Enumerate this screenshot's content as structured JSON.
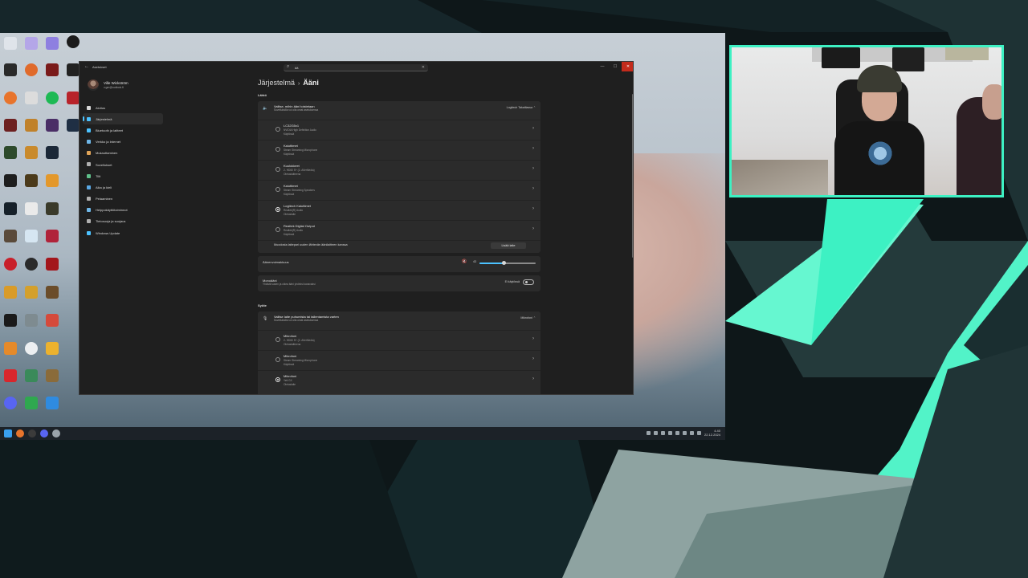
{
  "colors": {
    "overlay_bg": "#0d1517",
    "overlay_accent": "#3df1c3",
    "settings_bg": "#1f1f1f",
    "card_bg": "#2b2b2b",
    "accent_blue": "#4cc2ff",
    "close_red": "#c42b1c"
  },
  "window": {
    "app_title": "Asetukset",
    "search_value": "ää",
    "back_icon": "back-arrow-icon",
    "minimize_icon": "minimize-icon",
    "maximize_icon": "maximize-icon",
    "close_icon": "close-icon"
  },
  "profile": {
    "name": "Ville Wickström",
    "email": "v.gm@outlook.fi"
  },
  "nav": [
    {
      "label": "Aloitus",
      "icon": "home-icon",
      "color": "#d9d9d9",
      "active": false
    },
    {
      "label": "Järjestelmä",
      "icon": "monitor-icon",
      "color": "#4cc2ff",
      "active": true
    },
    {
      "label": "Bluetooth ja laitteet",
      "icon": "bluetooth-icon",
      "color": "#4cc2ff",
      "active": false
    },
    {
      "label": "Verkko ja Internet",
      "icon": "wifi-icon",
      "color": "#6fb7e8",
      "active": false
    },
    {
      "label": "Mukauttaminen",
      "icon": "brush-icon",
      "color": "#e0a458",
      "active": false
    },
    {
      "label": "Sovellukset",
      "icon": "apps-icon",
      "color": "#b0b0b0",
      "active": false
    },
    {
      "label": "Tilit",
      "icon": "account-icon",
      "color": "#5fc08a",
      "active": false
    },
    {
      "label": "Aika ja kieli",
      "icon": "globe-clock-icon",
      "color": "#5aa9e6",
      "active": false
    },
    {
      "label": "Pelaaminen",
      "icon": "gamepad-icon",
      "color": "#b0b0b0",
      "active": false
    },
    {
      "label": "Helppokäyttötoiminnot",
      "icon": "accessibility-icon",
      "color": "#6fb7e8",
      "active": false
    },
    {
      "label": "Tietosuoja ja suojaus",
      "icon": "shield-icon",
      "color": "#b0b0b0",
      "active": false
    },
    {
      "label": "Windows Update",
      "icon": "update-icon",
      "color": "#4cc2ff",
      "active": false
    }
  ],
  "breadcrumb": {
    "parent": "Järjestelmä",
    "separator": "›",
    "current": "Ääni"
  },
  "output": {
    "section_label": "Lähtö",
    "card_title": "Valitse, mihin ääni toistetaan",
    "card_subtitle": "Sovelluksilla voi olla omat asetuksensa",
    "card_right": "Logitech Takatilassa",
    "devices": [
      {
        "name": "LC32G5x1",
        "line1": "NVIDIA High Definition Audio",
        "line2": "Käytössä",
        "selected": false
      },
      {
        "name": "Kaiuttimet",
        "line1": "Steam Streaming Microphone",
        "line2": "Käytössä",
        "selected": false
      },
      {
        "name": "Kuulokkeet",
        "line1": "2- HD60 S+ (2- AVerMedia)",
        "line2": "Oletuslaitteena",
        "selected": false
      },
      {
        "name": "Kaiuttimet",
        "line1": "Steam Streaming Speakers",
        "line2": "Käytössä",
        "selected": false
      },
      {
        "name": "Logitech Kaiuttimet",
        "line1": "Realtek(R) Audio",
        "line2": "Oletuslaite",
        "selected": true
      },
      {
        "name": "Realtek Digital Output",
        "line1": "Realtek(R) Audio",
        "line2": "Käytössä",
        "selected": false
      }
    ],
    "pair_text": "Muodosta laitepari uuden lähtevän äänilaitteen kanssa",
    "pair_button": "Lisää laite",
    "volume_label": "Äänenvoimakkuus",
    "volume_value": 43,
    "volume_icon": "speaker-muted-icon",
    "mono_title": "Monoääni",
    "mono_subtitle": "Yhdistä vasen ja oikea ääni yhdeksi kanavaksi",
    "mono_state": "Ei käytössä",
    "mono_on": false
  },
  "input": {
    "section_label": "Syöte",
    "card_title": "Valitse laite puhumista tai tallentamista varten",
    "card_subtitle": "Sovelluksilla voi olla omat asetuksensa",
    "card_right": "Mikrofoni",
    "mic_icon": "microphone-icon",
    "devices": [
      {
        "name": "Mikrofoni",
        "line1": "2- HD60 S+ (2- AVerMedia)",
        "line2": "Oletuslaitteena",
        "selected": false
      },
      {
        "name": "Mikrofoni",
        "line1": "Steam Streaming Microphone",
        "line2": "Käytössä",
        "selected": false
      },
      {
        "name": "Mikrofoni",
        "line1": "Yeti GX",
        "line2": "Oletuslaite",
        "selected": true
      }
    ]
  },
  "taskbar": {
    "time": "4.40",
    "date": "22.12.2024"
  }
}
